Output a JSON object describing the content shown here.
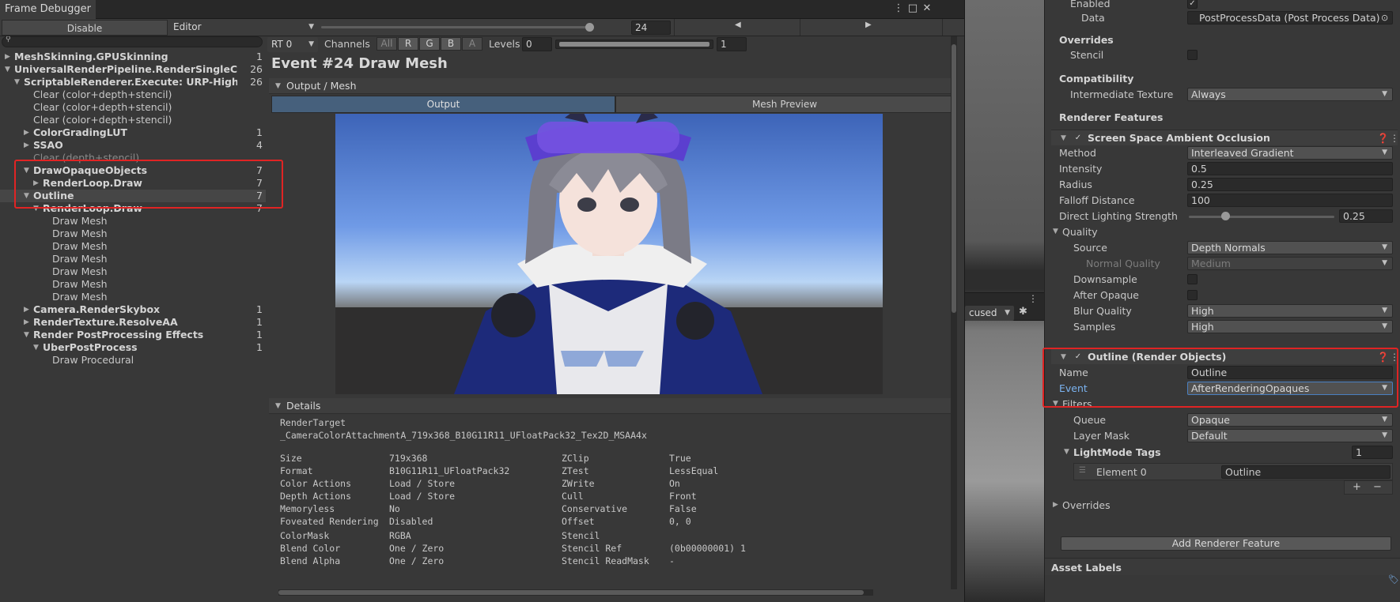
{
  "window": {
    "title": "Frame Debugger",
    "disable_label": "Disable",
    "target_dropdown": "Editor",
    "event_number": "24"
  },
  "tree": {
    "items": [
      {
        "label": "MeshSkinning.GPUSkinning",
        "count": "1",
        "bold": true,
        "collapsed": true,
        "indent": 0
      },
      {
        "label": "UniversalRenderPipeline.RenderSingleCameraInternal",
        "count": "26",
        "bold": true,
        "expanded": true,
        "indent": 0
      },
      {
        "label": "ScriptableRenderer.Execute: URP-HighFidelity-Renderer",
        "count": "26",
        "bold": true,
        "expanded": true,
        "indent": 1
      },
      {
        "label": "Clear (color+depth+stencil)",
        "count": "",
        "indent": 2
      },
      {
        "label": "Clear (color+depth+stencil)",
        "count": "",
        "indent": 2
      },
      {
        "label": "Clear (color+depth+stencil)",
        "count": "",
        "indent": 2
      },
      {
        "label": "ColorGradingLUT",
        "count": "1",
        "bold": true,
        "collapsed": true,
        "indent": 2
      },
      {
        "label": "SSAO",
        "count": "4",
        "bold": true,
        "collapsed": true,
        "indent": 2
      },
      {
        "label": "Clear (depth+stencil)",
        "count": "",
        "dim": true,
        "indent": 2
      },
      {
        "label": "DrawOpaqueObjects",
        "count": "7",
        "bold": true,
        "expanded": true,
        "indent": 2
      },
      {
        "label": "RenderLoop.Draw",
        "count": "7",
        "bold": true,
        "collapsed": true,
        "indent": 3
      },
      {
        "label": "Outline",
        "count": "7",
        "bold": true,
        "expanded": true,
        "indent": 2,
        "selected": true
      },
      {
        "label": "RenderLoop.Draw",
        "count": "7",
        "bold": true,
        "expanded": true,
        "indent": 3
      },
      {
        "label": "Draw Mesh",
        "count": "",
        "indent": 4
      },
      {
        "label": "Draw Mesh",
        "count": "",
        "indent": 4
      },
      {
        "label": "Draw Mesh",
        "count": "",
        "indent": 4
      },
      {
        "label": "Draw Mesh",
        "count": "",
        "indent": 4
      },
      {
        "label": "Draw Mesh",
        "count": "",
        "indent": 4
      },
      {
        "label": "Draw Mesh",
        "count": "",
        "indent": 4
      },
      {
        "label": "Draw Mesh",
        "count": "",
        "indent": 4
      },
      {
        "label": "Camera.RenderSkybox",
        "count": "1",
        "bold": true,
        "collapsed": true,
        "indent": 2
      },
      {
        "label": "RenderTexture.ResolveAA",
        "count": "1",
        "bold": true,
        "collapsed": true,
        "indent": 2
      },
      {
        "label": "Render PostProcessing Effects",
        "count": "1",
        "bold": true,
        "expanded": true,
        "indent": 2
      },
      {
        "label": "UberPostProcess",
        "count": "1",
        "bold": true,
        "expanded": true,
        "indent": 3
      },
      {
        "label": "Draw Procedural",
        "count": "",
        "indent": 4
      }
    ]
  },
  "main": {
    "rt_dropdown": "RT 0",
    "channels_label": "Channels",
    "channels": [
      "All",
      "R",
      "G",
      "B",
      "A"
    ],
    "levels_label": "Levels",
    "levels_min": "0",
    "levels_max": "1",
    "event_title": "Event #24 Draw Mesh",
    "output_section": "Output / Mesh",
    "tab_output": "Output",
    "tab_mesh_preview": "Mesh Preview",
    "details_section": "Details",
    "render_target_label": "RenderTarget",
    "render_target_value": "_CameraColorAttachmentA_719x368_B10G11R11_UFloatPack32_Tex2D_MSAA4x",
    "props_left": [
      {
        "k": "Size",
        "v": "719x368"
      },
      {
        "k": "Format",
        "v": "B10G11R11_UFloatPack32"
      },
      {
        "k": "Color Actions",
        "v": "Load / Store"
      },
      {
        "k": "Depth Actions",
        "v": "Load / Store"
      },
      {
        "k": "Memoryless",
        "v": "No"
      },
      {
        "k": "Foveated Rendering",
        "v": "Disabled"
      }
    ],
    "props_right": [
      {
        "k": "ZClip",
        "v": "True"
      },
      {
        "k": "ZTest",
        "v": "LessEqual"
      },
      {
        "k": "ZWrite",
        "v": "On"
      },
      {
        "k": "Cull",
        "v": "Front"
      },
      {
        "k": "Conservative",
        "v": "False"
      },
      {
        "k": "Offset",
        "v": "0, 0"
      }
    ],
    "props_left2": [
      {
        "k": "ColorMask",
        "v": "RGBA"
      },
      {
        "k": "Blend Color",
        "v": "One / Zero"
      },
      {
        "k": "Blend Alpha",
        "v": "One / Zero"
      }
    ],
    "props_right2": [
      {
        "k": "Stencil",
        "v": ""
      },
      {
        "k": "Stencil Ref",
        "v": "(0b00000001) 1"
      },
      {
        "k": "Stencil ReadMask",
        "v": "-"
      }
    ]
  },
  "scene": {
    "focus_dropdown": "cused"
  },
  "inspector": {
    "enabled_label": "Enabled",
    "data_label": "Data",
    "data_value": "PostProcessData (Post Process Data)",
    "overrides_head": "Overrides",
    "stencil_label": "Stencil",
    "compat_head": "Compatibility",
    "intermediate_label": "Intermediate Texture",
    "intermediate_value": "Always",
    "renderer_features_head": "Renderer Features",
    "ssao": {
      "title": "Screen Space Ambient Occlusion",
      "method_label": "Method",
      "method_value": "Interleaved Gradient",
      "intensity_label": "Intensity",
      "intensity_value": "0.5",
      "radius_label": "Radius",
      "radius_value": "0.25",
      "falloff_label": "Falloff Distance",
      "falloff_value": "100",
      "dls_label": "Direct Lighting Strength",
      "dls_value": "0.25",
      "dls_fraction": 0.25,
      "quality_head": "Quality",
      "source_label": "Source",
      "source_value": "Depth Normals",
      "normal_quality_label": "Normal Quality",
      "normal_quality_value": "Medium",
      "downsample_label": "Downsample",
      "after_opaque_label": "After Opaque",
      "blur_label": "Blur Quality",
      "blur_value": "High",
      "samples_label": "Samples",
      "samples_value": "High"
    },
    "outline": {
      "title": "Outline (Render Objects)",
      "name_label": "Name",
      "name_value": "Outline",
      "event_label": "Event",
      "event_value": "AfterRenderingOpaques",
      "filters_head": "Filters",
      "queue_label": "Queue",
      "queue_value": "Opaque",
      "layer_mask_label": "Layer Mask",
      "layer_mask_value": "Default",
      "lightmode_label": "LightMode Tags",
      "lightmode_count": "1",
      "element0_label": "Element 0",
      "element0_value": "Outline",
      "overrides_label": "Overrides"
    },
    "add_feature_label": "Add Renderer Feature",
    "asset_labels": "Asset Labels"
  }
}
